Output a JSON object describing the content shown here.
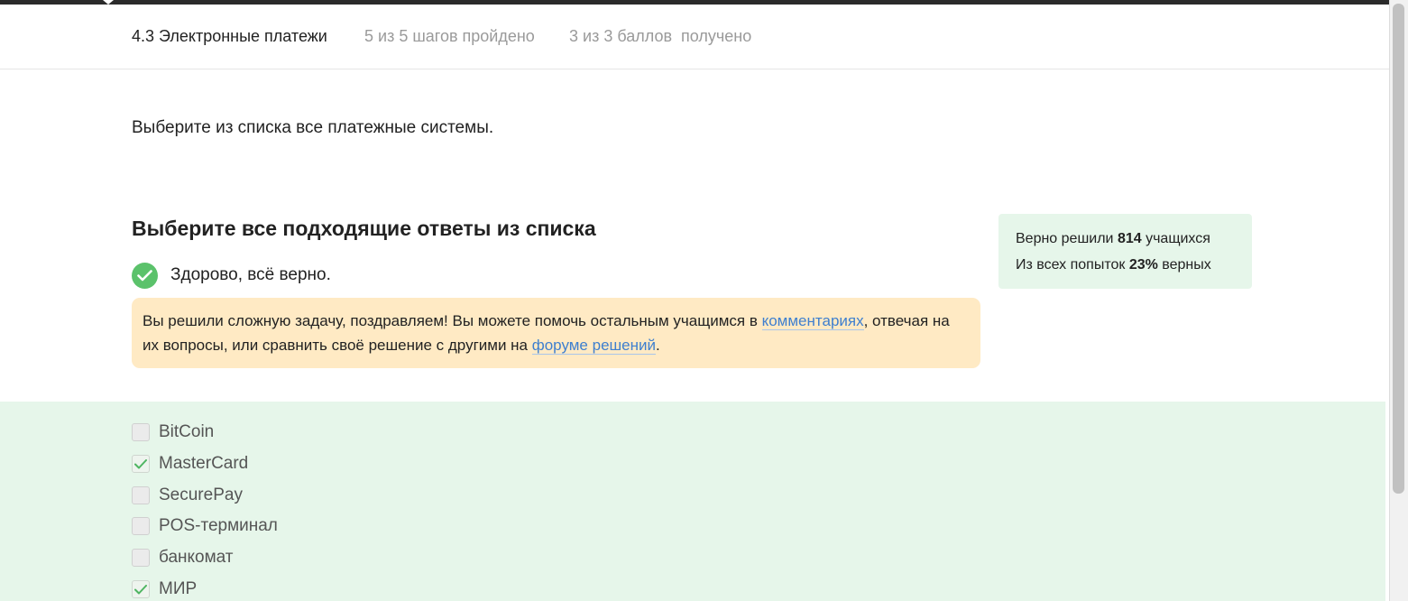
{
  "lesson": {
    "title": "4.3 Электронные платежи",
    "steps": "5 из 5 шагов пройдено",
    "score": "3 из 3 баллов  получено"
  },
  "task": {
    "text": "Выберите из списка все платежные системы."
  },
  "quiz": {
    "title": "Выберите все подходящие ответы из списка",
    "result": "Здорово, всё верно.",
    "hint": {
      "part1": "Вы решили сложную задачу, поздравляем! Вы можете помочь остальным учащимся в ",
      "link1": "комментариях",
      "part2": ", отвечая на их вопросы, или сравнить своё решение с другими на ",
      "link2": "форуме решений",
      "part3": "."
    }
  },
  "stats": {
    "solved_prefix": "Верно решили ",
    "solved_count": "814",
    "solved_suffix": " учащихся",
    "attempts_prefix": "Из всех попыток ",
    "attempts_percent": "23%",
    "attempts_suffix": " верных"
  },
  "options": [
    {
      "label": "BitCoin",
      "checked": false
    },
    {
      "label": "MasterCard",
      "checked": true
    },
    {
      "label": "SecurePay",
      "checked": false
    },
    {
      "label": "POS-терминал",
      "checked": false
    },
    {
      "label": "банкомат",
      "checked": false
    },
    {
      "label": "МИР",
      "checked": true
    }
  ],
  "colors": {
    "success": "#5bc26b",
    "hint_bg": "#ffeac4",
    "stats_bg": "#e6f6ea",
    "link": "#3e7fcf"
  }
}
